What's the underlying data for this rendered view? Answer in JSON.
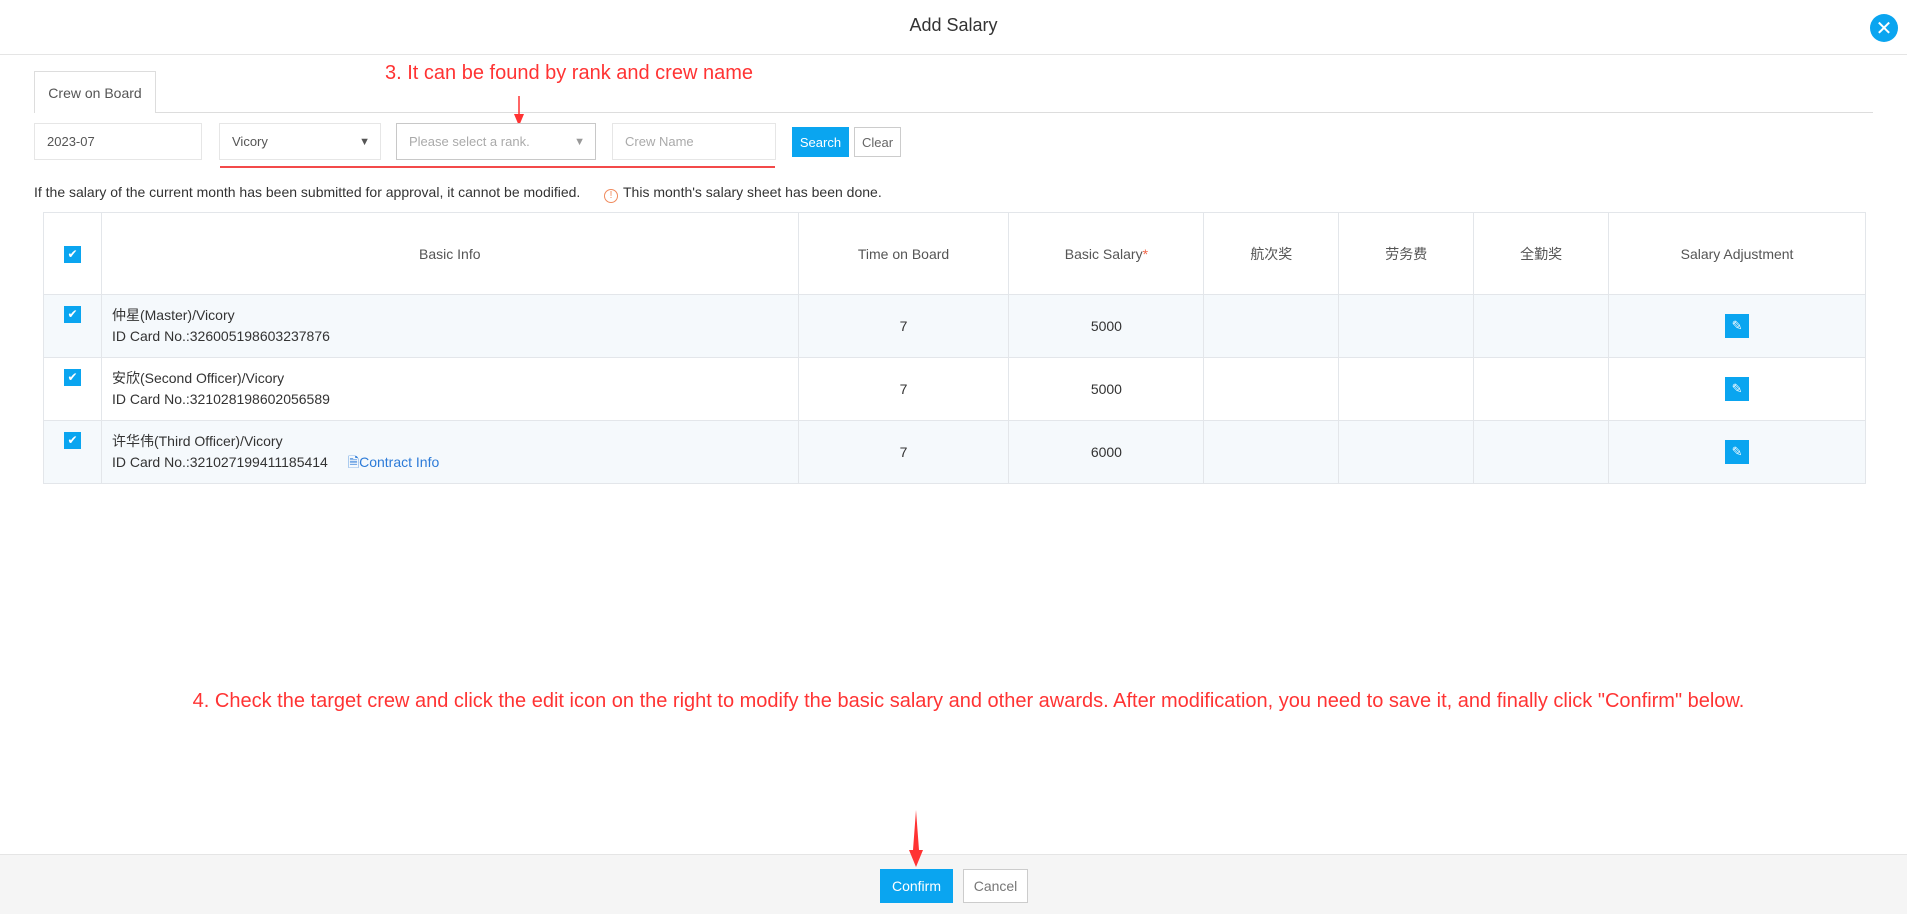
{
  "dialog": {
    "title": "Add Salary",
    "close_icon": "close-icon"
  },
  "tabs": [
    {
      "label": "Crew on Board",
      "active": true
    }
  ],
  "filters": {
    "month": "2023-07",
    "vessel": "Vicory",
    "rank_placeholder": "Please select a rank.",
    "crew_name_placeholder": "Crew Name",
    "search_label": "Search",
    "clear_label": "Clear"
  },
  "notice": {
    "info": "If the salary of the current month has been submitted for approval, it cannot be modified.",
    "warning": "This month's salary sheet has been done."
  },
  "annotations": {
    "step3": "3. It can be found by rank and crew name",
    "step4": "4. Check the target crew and click the edit icon on the right to modify the basic salary and other awards. After modification, you need to save it, and finally click \"Confirm\" below."
  },
  "table": {
    "headers": [
      "Basic Info",
      "Time on Board",
      "Basic Salary",
      "航次奖",
      "劳务费",
      "全勤奖",
      "Salary Adjustment"
    ],
    "required_mark": "*",
    "rows": [
      {
        "name": "仲星(Master)/Vicory",
        "id": "ID Card No.:326005198603237876",
        "time": "7",
        "salary": "5000",
        "checked": true
      },
      {
        "name": "安欣(Second Officer)/Vicory",
        "id": "ID Card No.:321028198602056589",
        "time": "7",
        "salary": "5000",
        "checked": true
      },
      {
        "name": "许华伟(Third Officer)/Vicory",
        "id": "ID Card No.:321027199411185414",
        "time": "7",
        "salary": "6000",
        "checked": true,
        "link": "Contract Info"
      }
    ]
  },
  "footer": {
    "confirm_label": "Confirm",
    "cancel_label": "Cancel"
  },
  "colors": {
    "accent": "#0aa5f0",
    "annotation": "#ff3333"
  }
}
